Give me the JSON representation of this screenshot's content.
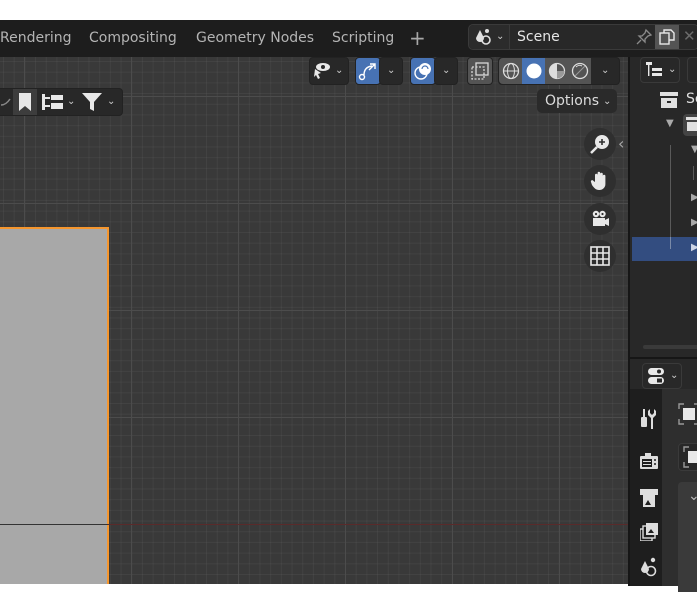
{
  "topbar": {
    "workspace_tabs": [
      "Rendering",
      "Compositing",
      "Geometry Nodes",
      "Scripting"
    ],
    "add_workspace": "+",
    "scene_selector": {
      "icon": "scene-icon",
      "name": "Scene",
      "pin_icon": "pin-icon",
      "new_scene_icon": "duplicate-icon",
      "close_icon": "close-icon",
      "close_glyph": "✕"
    }
  },
  "viewport": {
    "header": {
      "left_tools": [
        "annotate-icon",
        "bookmark-icon",
        "arrange-icon",
        "filter-icon"
      ],
      "visibility_dropdown": "eye-selectability-icon",
      "gizmo_toggle": {
        "icon": "gizmo-icon",
        "active": true
      },
      "overlay_toggle": {
        "icon": "overlay-icon",
        "active": true
      },
      "xray_toggle": "xray-icon",
      "shading_modes": [
        {
          "name": "wireframe",
          "active": false
        },
        {
          "name": "solid",
          "active": true
        },
        {
          "name": "material-preview",
          "active": false
        },
        {
          "name": "rendered",
          "active": false
        }
      ],
      "options_label": "Options"
    },
    "navigation_gizmos": [
      "zoom-icon",
      "hand-pan-icon",
      "camera-icon",
      "ortho-grid-icon"
    ],
    "sidebar_toggle": "‹",
    "colors": {
      "background": "#393939",
      "selection_outline": "#f5962e",
      "object_fill": "#a8a8a8",
      "x_axis": "#5a2a2a",
      "accent_blue": "#4772b3"
    }
  },
  "outliner": {
    "display_mode_icon": "outliner-display-icon",
    "rows": [
      {
        "label": "Sc",
        "icon": "scene-collection-icon"
      },
      {
        "expanded": true,
        "icon": "collection-icon"
      },
      {
        "expanded": true
      },
      {
        "expanded": false
      },
      {
        "expanded": false
      },
      {
        "expanded": false,
        "selected": true
      }
    ]
  },
  "properties": {
    "editor_icon": "properties-editor-icon",
    "tabs": [
      "tool-icon",
      "render-icon",
      "output-icon",
      "view-layer-icon",
      "scene-icon"
    ],
    "colors": {
      "selected_row": "#334d80"
    }
  }
}
